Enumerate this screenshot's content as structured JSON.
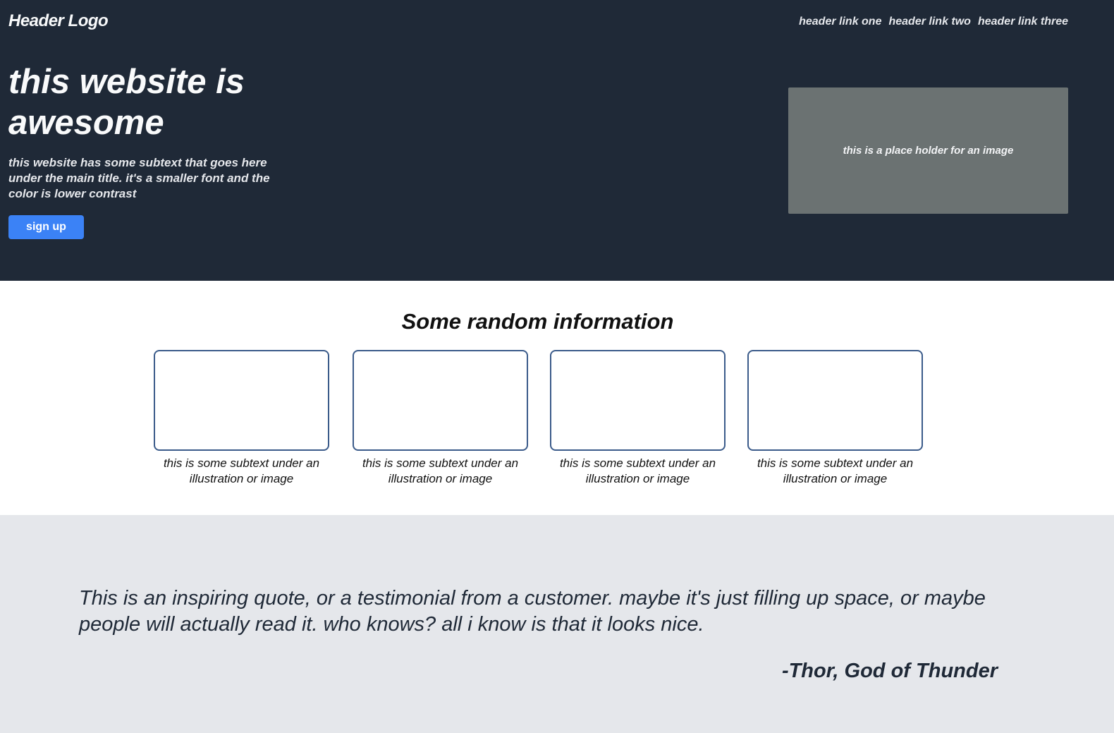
{
  "header": {
    "logo": "Header Logo",
    "links": [
      "header link one",
      "header link two",
      "header link three"
    ]
  },
  "hero": {
    "title": "this website is awesome",
    "subtext": "this website has some subtext that goes here under the main title. it's a smaller font and the color is lower contrast",
    "cta_label": "sign up",
    "image_placeholder": "this is a place holder for an image"
  },
  "info": {
    "title": "Some random information",
    "cards": [
      {
        "caption": "this is some subtext under an illustration or image"
      },
      {
        "caption": "this is some subtext under an illustration or image"
      },
      {
        "caption": "this is some subtext under an illustration or image"
      },
      {
        "caption": "this is some subtext under an illustration or image"
      }
    ]
  },
  "quote": {
    "text": "This is an inspiring quote, or a testimonial from a customer. maybe it's just filling up space, or maybe people will actually read it. who knows? all i know is that it looks nice.",
    "author": "-Thor, God of Thunder"
  },
  "colors": {
    "header_bg": "#1f2937",
    "accent": "#3b82f6",
    "placeholder_bg": "#6b7272",
    "card_border": "#3b5b8a",
    "quote_bg": "#e5e7eb"
  }
}
